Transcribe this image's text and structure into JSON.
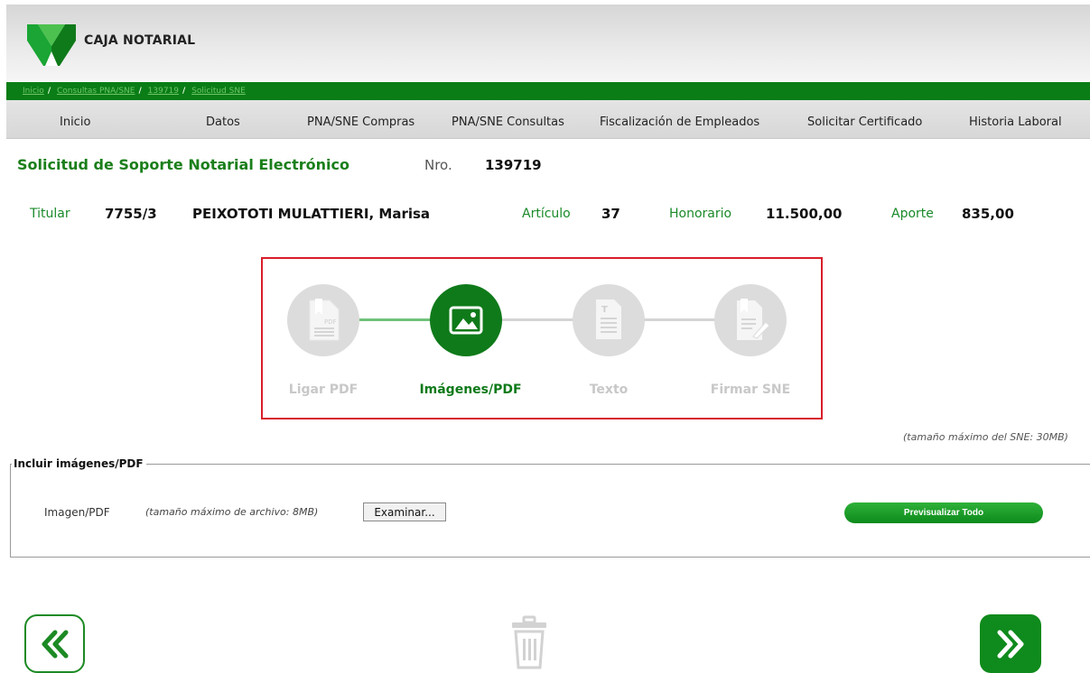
{
  "header": {
    "brand": "CAJA NOTARIAL",
    "logo_icon": "caja-notarial-logo"
  },
  "breadcrumb": {
    "items": [
      "Inicio",
      "Consultas PNA/SNE",
      "139719",
      "Solicitud SNE"
    ]
  },
  "nav": {
    "items": [
      "Inicio",
      "Datos",
      "PNA/SNE Compras",
      "PNA/SNE Consultas",
      "Fiscalización de Empleados",
      "Solicitar Certificado",
      "Historia Laboral"
    ]
  },
  "title": {
    "text": "Solicitud de Soporte Notarial Electrónico",
    "nro_label": "Nro.",
    "nro_value": "139719"
  },
  "info": {
    "titular_label": "Titular",
    "titular_code": "7755/3",
    "titular_name": "PEIXOTOTI MULATTIERI, Marisa",
    "articulo_label": "Artículo",
    "articulo_value": "37",
    "honorario_label": "Honorario",
    "honorario_value": "11.500,00",
    "aporte_label": "Aporte",
    "aporte_value": "835,00"
  },
  "stepper": {
    "steps": [
      {
        "label": "Ligar PDF",
        "icon": "pdf-document-icon",
        "active": false
      },
      {
        "label": "Imágenes/PDF",
        "icon": "image-icon",
        "active": true
      },
      {
        "label": "Texto",
        "icon": "text-document-icon",
        "active": false
      },
      {
        "label": "Firmar SNE",
        "icon": "sign-document-icon",
        "active": false
      }
    ]
  },
  "upload": {
    "max_sne_note": "(tamaño máximo del SNE: 30MB)",
    "legend": "Incluir imágenes/PDF",
    "file_label": "Imagen/PDF",
    "file_hint": "(tamaño máximo de archivo: 8MB)",
    "browse_label": "Examinar...",
    "preview_label": "Previsualizar Todo"
  },
  "bottom_nav": {
    "back_icon": "double-chevron-left-icon",
    "trash_icon": "trash-icon",
    "forward_icon": "double-chevron-right-icon"
  },
  "colors": {
    "brand_green": "#0a7d16",
    "active_step": "#0f7a1a",
    "inactive_step": "#dcdcdc",
    "highlight_frame": "#d91e2a"
  }
}
